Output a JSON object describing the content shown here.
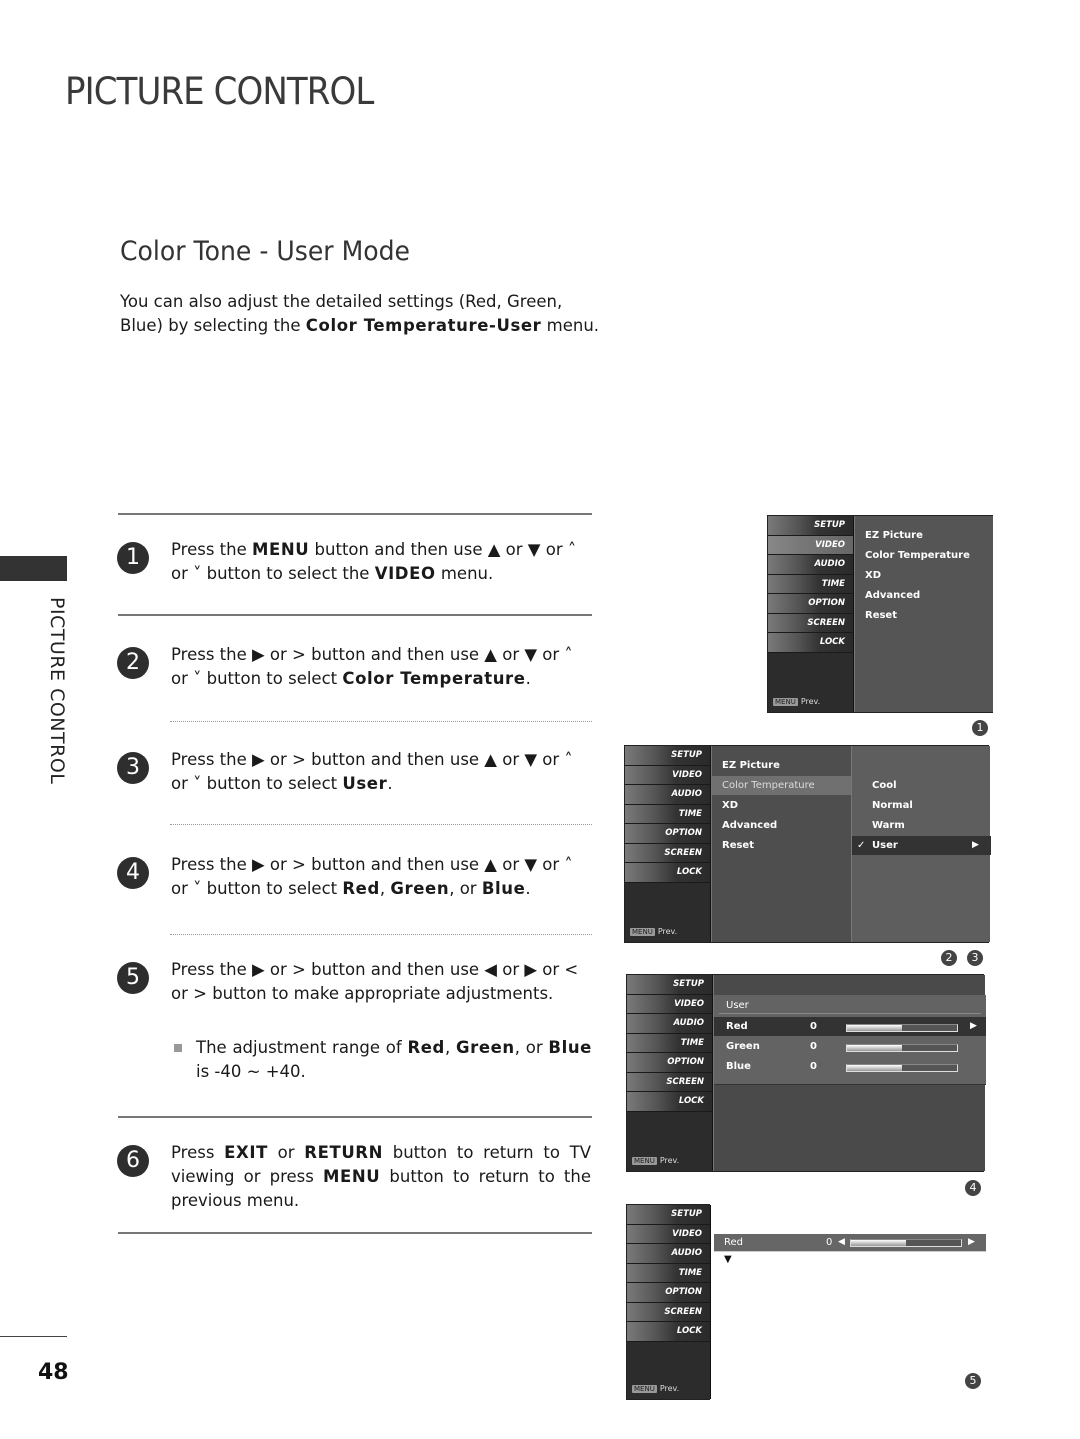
{
  "page": {
    "title": "PICTURE CONTROL",
    "side_label": "PICTURE CONTROL",
    "page_number": "48"
  },
  "section": {
    "title": "Color Tone - User Mode",
    "intro_plain_1": "You can also adjust the detailed settings (Red, Green, Blue) by selecting the ",
    "intro_bold": "Color Temperature-User",
    "intro_plain_2": " menu."
  },
  "steps": [
    {
      "num": "1",
      "parts": [
        {
          "t": "Press the "
        },
        {
          "b": "MENU"
        },
        {
          "t": " button and then use ▲ or ▼  or  ˄  or  ˅  button to select the "
        },
        {
          "b": "VIDEO"
        },
        {
          "t": " menu."
        }
      ]
    },
    {
      "num": "2",
      "parts": [
        {
          "t": "Press the  ▶  or  > button and then use ▲ or ▼  or  ˄  or  ˅  button to select "
        },
        {
          "b": "Color Temperature"
        },
        {
          "t": "."
        }
      ]
    },
    {
      "num": "3",
      "parts": [
        {
          "t": "Press the  ▶  or  > button and then use ▲ or ▼  or  ˄  or  ˅  button to select "
        },
        {
          "b": "User"
        },
        {
          "t": "."
        }
      ]
    },
    {
      "num": "4",
      "parts": [
        {
          "t": "Press the  ▶  or  > button and then use ▲ or ▼  or  ˄  or  ˅  button to select "
        },
        {
          "b": "Red"
        },
        {
          "t": ", "
        },
        {
          "b": "Green"
        },
        {
          "t": ", or "
        },
        {
          "b": "Blue"
        },
        {
          "t": "."
        }
      ]
    },
    {
      "num": "5",
      "parts": [
        {
          "t": "Press the  ▶  or  > button and then use ◀ or ▶ or  <  or  >    button to make appropriate adjustments."
        }
      ],
      "note_parts": [
        {
          "t": "The adjustment range of "
        },
        {
          "b": "Red"
        },
        {
          "t": ", "
        },
        {
          "b": "Green"
        },
        {
          "t": ", or "
        },
        {
          "b": "Blue"
        },
        {
          "t": " is -40 ~ +40."
        }
      ]
    },
    {
      "num": "6",
      "parts": [
        {
          "t": "Press "
        },
        {
          "b": "EXIT"
        },
        {
          "t": " or "
        },
        {
          "b": "RETURN"
        },
        {
          "t": " button to return to TV viewing or press "
        },
        {
          "b": "MENU"
        },
        {
          "t": " button to return to the previous menu."
        }
      ]
    }
  ],
  "osd": {
    "side_menu": [
      "SETUP",
      "VIDEO",
      "AUDIO",
      "TIME",
      "OPTION",
      "SCREEN",
      "LOCK"
    ],
    "prev_key": "MENU",
    "prev_label": "Prev.",
    "video_items": [
      "EZ Picture",
      "Color Temperature",
      "XD",
      "Advanced",
      "Reset"
    ],
    "color_temp_options": [
      "Cool",
      "Normal",
      "Warm",
      "User"
    ],
    "selected_option": "User",
    "check_icon": "✓",
    "right_arrow": "▶",
    "left_arrow": "◀",
    "down_arrow": "▼",
    "user_title": "User",
    "user_rows": [
      {
        "label": "Red",
        "value": "0",
        "level": 0.5
      },
      {
        "label": "Green",
        "value": "0",
        "level": 0.5
      },
      {
        "label": "Blue",
        "value": "0",
        "level": 0.5
      }
    ],
    "adjust_row": {
      "label": "Red",
      "value": "0",
      "level": 0.5
    },
    "figure_labels": [
      "1",
      "2",
      "3",
      "4",
      "5"
    ]
  }
}
